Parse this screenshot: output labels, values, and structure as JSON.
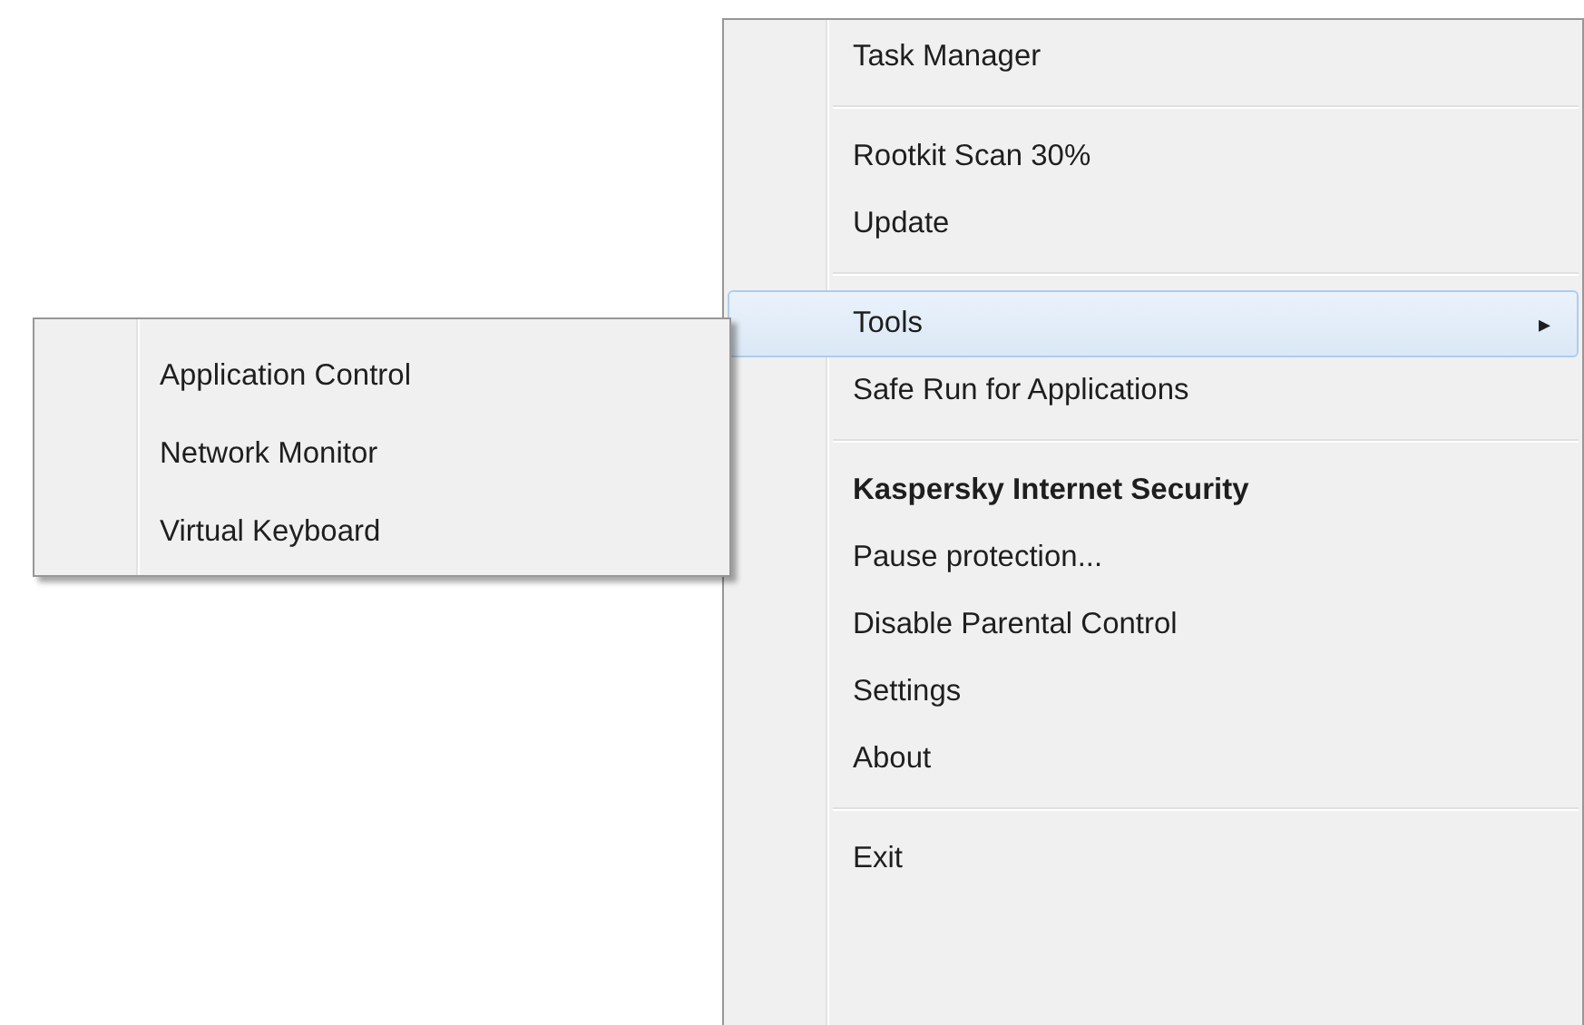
{
  "context_menu": {
    "items": [
      {
        "kind": "item",
        "label": "Task Manager",
        "selected": false
      },
      {
        "kind": "separator"
      },
      {
        "kind": "item",
        "label": "Rootkit Scan 30%",
        "selected": false
      },
      {
        "kind": "item",
        "label": "Update",
        "selected": false
      },
      {
        "kind": "separator"
      },
      {
        "kind": "submenu",
        "label": "Tools",
        "selected": true,
        "arrow": "▸"
      },
      {
        "kind": "item",
        "label": "Safe Run for Applications",
        "selected": false
      },
      {
        "kind": "separator"
      },
      {
        "kind": "header",
        "label": "Kaspersky Internet Security",
        "selected": false
      },
      {
        "kind": "item",
        "label": "Pause protection...",
        "selected": false
      },
      {
        "kind": "item",
        "label": "Disable Parental Control",
        "selected": false
      },
      {
        "kind": "item",
        "label": "Settings",
        "selected": false
      },
      {
        "kind": "item",
        "label": "About",
        "selected": false
      },
      {
        "kind": "separator"
      },
      {
        "kind": "item",
        "label": "Exit",
        "selected": false
      }
    ]
  },
  "submenu": {
    "items": [
      {
        "label": "Application Control",
        "selected": false
      },
      {
        "label": "Network Monitor",
        "selected": false
      },
      {
        "label": "Virtual Keyboard",
        "selected": false
      }
    ]
  }
}
